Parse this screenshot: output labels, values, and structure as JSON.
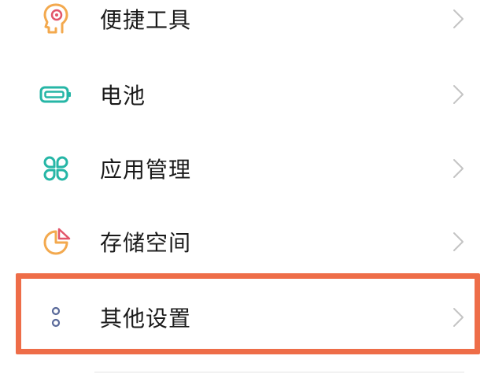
{
  "settings": {
    "items": [
      {
        "label": "便捷工具",
        "icon": "head-gear-icon",
        "icon_color": "#f3a94e"
      },
      {
        "label": "电池",
        "icon": "battery-icon",
        "icon_color": "#26b6a6"
      },
      {
        "label": "应用管理",
        "icon": "app-grid-icon",
        "icon_color": "#26b6a6"
      },
      {
        "label": "存储空间",
        "icon": "pie-chart-icon",
        "icon_color": "#f3a94e"
      },
      {
        "label": "其他设置",
        "icon": "more-dots-icon",
        "icon_color": "#5a6a9a"
      }
    ],
    "highlighted_item": "其他设置"
  },
  "colors": {
    "highlight_border": "#ee6d48",
    "chevron": "#c4c4c4",
    "text": "#1a1a1a"
  }
}
